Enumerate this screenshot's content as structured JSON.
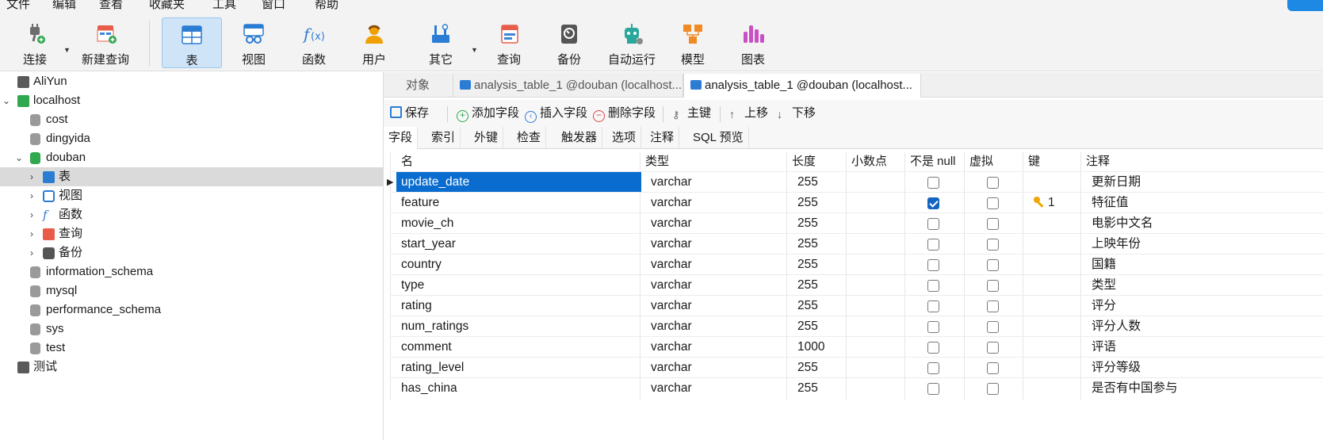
{
  "menu": [
    "文件",
    "编辑",
    "查看",
    "收藏夹",
    "工具",
    "窗口",
    "帮助"
  ],
  "toolbar": {
    "connect": "连接",
    "new_query": "新建查询",
    "table": "表",
    "view": "视图",
    "function": "函数",
    "user": "用户",
    "other": "其它",
    "query": "查询",
    "backup": "备份",
    "automation": "自动运行",
    "model": "模型",
    "chart": "图表"
  },
  "tree": {
    "aliyun": "AliYun",
    "localhost": "localhost",
    "cost": "cost",
    "dingyida": "dingyida",
    "douban": "douban",
    "tables": "表",
    "views": "视图",
    "functions": "函数",
    "queries": "查询",
    "backups": "备份",
    "information_schema": "information_schema",
    "mysql": "mysql",
    "performance_schema": "performance_schema",
    "sys": "sys",
    "test": "test",
    "test_conn": "测试"
  },
  "tabs": {
    "objects": "对象",
    "tab1": "analysis_table_1 @douban (localhost...",
    "tab2": "analysis_table_1 @douban (localhost..."
  },
  "actions": {
    "save": "保存",
    "add_field": "添加字段",
    "insert_field": "插入字段",
    "delete_field": "删除字段",
    "primary_key": "主键",
    "move_up": "上移",
    "move_down": "下移"
  },
  "subtabs": [
    "字段",
    "索引",
    "外键",
    "检查",
    "触发器",
    "选项",
    "注释",
    "SQL 预览"
  ],
  "columns": {
    "name": "名",
    "type": "类型",
    "length": "长度",
    "decimals": "小数点",
    "not_null": "不是 null",
    "virtual": "虚拟",
    "key": "键",
    "comment": "注释"
  },
  "rows": [
    {
      "name": "update_date",
      "type": "varchar",
      "length": "255",
      "not_null": false,
      "key": "",
      "comment": "更新日期"
    },
    {
      "name": "feature",
      "type": "varchar",
      "length": "255",
      "not_null": true,
      "key": "1",
      "comment": "特征值"
    },
    {
      "name": "movie_ch",
      "type": "varchar",
      "length": "255",
      "not_null": false,
      "key": "",
      "comment": "电影中文名"
    },
    {
      "name": "start_year",
      "type": "varchar",
      "length": "255",
      "not_null": false,
      "key": "",
      "comment": "上映年份"
    },
    {
      "name": "country",
      "type": "varchar",
      "length": "255",
      "not_null": false,
      "key": "",
      "comment": "国籍"
    },
    {
      "name": "type",
      "type": "varchar",
      "length": "255",
      "not_null": false,
      "key": "",
      "comment": "类型"
    },
    {
      "name": "rating",
      "type": "varchar",
      "length": "255",
      "not_null": false,
      "key": "",
      "comment": "评分"
    },
    {
      "name": "num_ratings",
      "type": "varchar",
      "length": "255",
      "not_null": false,
      "key": "",
      "comment": "评分人数"
    },
    {
      "name": "comment",
      "type": "varchar",
      "length": "1000",
      "not_null": false,
      "key": "",
      "comment": "评语"
    },
    {
      "name": "rating_level",
      "type": "varchar",
      "length": "255",
      "not_null": false,
      "key": "",
      "comment": "评分等级"
    },
    {
      "name": "has_china",
      "type": "varchar",
      "length": "255",
      "not_null": false,
      "key": "",
      "comment": "是否有中国参与"
    }
  ],
  "colors": {
    "accent": "#0a6ccf",
    "active_toolbar": "#cfe4f7",
    "checkbox_on": "#1565c0",
    "key_icon": "#f0a500"
  }
}
